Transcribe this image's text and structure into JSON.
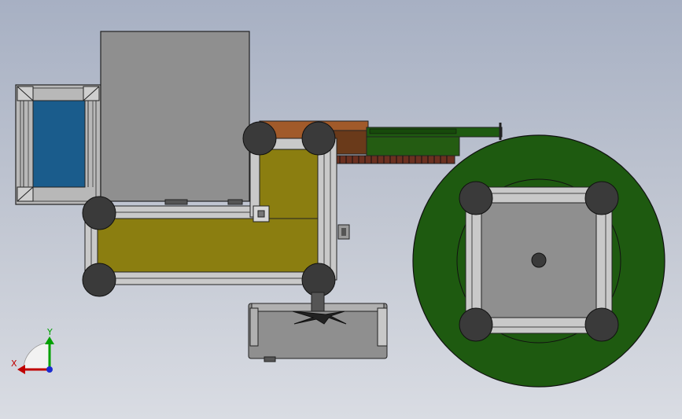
{
  "viewport": {
    "background_top": "#a7b0c3",
    "background_bottom": "#d9dce3"
  },
  "colors": {
    "frame_gray": "#8f8f8f",
    "frame_light": "#d0d0d0",
    "olive_panel": "#8b7e10",
    "blue_panel": "#1a5c8c",
    "green_disc": "#1e5a10",
    "copper": "#a15a2a",
    "foot_dark": "#3a3a3a",
    "axis_x": "#c00000",
    "axis_y": "#00a000",
    "axis_z": "#1a2bd0"
  },
  "triad": {
    "x_label": "X",
    "y_label": "Y",
    "icon": "coordinate-triad-icon"
  }
}
